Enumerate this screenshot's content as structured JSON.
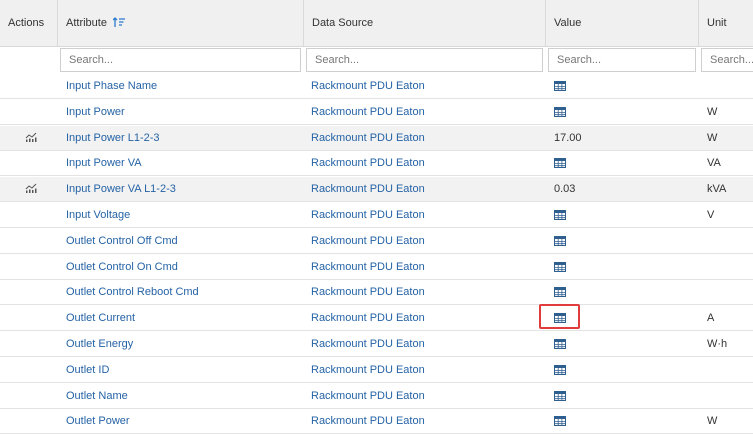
{
  "header": {
    "actions": "Actions",
    "attribute": "Attribute",
    "data_source": "Data Source",
    "value": "Value",
    "unit": "Unit"
  },
  "search": {
    "attribute_placeholder": "Search...",
    "data_source_placeholder": "Search...",
    "value_placeholder": "Search...",
    "unit_placeholder": "Search..."
  },
  "rows": [
    {
      "attribute": "Input Phase Name",
      "source": "Rackmount PDU Eaton",
      "value": "",
      "unit": "",
      "value_icon": "table-icon",
      "action_icon": ""
    },
    {
      "attribute": "Input Power",
      "source": "Rackmount PDU Eaton",
      "value": "",
      "unit": "W",
      "value_icon": "table-icon",
      "action_icon": ""
    },
    {
      "attribute": "Input Power L1-2-3",
      "source": "Rackmount PDU Eaton",
      "value": "17.00",
      "unit": "W",
      "value_icon": "",
      "action_icon": "trend-chart-icon"
    },
    {
      "attribute": "Input Power VA",
      "source": "Rackmount PDU Eaton",
      "value": "",
      "unit": "VA",
      "value_icon": "table-icon",
      "action_icon": ""
    },
    {
      "attribute": "Input Power VA L1-2-3",
      "source": "Rackmount PDU Eaton",
      "value": "0.03",
      "unit": "kVA",
      "value_icon": "",
      "action_icon": "trend-chart-icon"
    },
    {
      "attribute": "Input Voltage",
      "source": "Rackmount PDU Eaton",
      "value": "",
      "unit": "V",
      "value_icon": "table-icon",
      "action_icon": ""
    },
    {
      "attribute": "Outlet Control Off Cmd",
      "source": "Rackmount PDU Eaton",
      "value": "",
      "unit": "",
      "value_icon": "table-icon",
      "action_icon": ""
    },
    {
      "attribute": "Outlet Control On Cmd",
      "source": "Rackmount PDU Eaton",
      "value": "",
      "unit": "",
      "value_icon": "table-icon",
      "action_icon": ""
    },
    {
      "attribute": "Outlet Control Reboot Cmd",
      "source": "Rackmount PDU Eaton",
      "value": "",
      "unit": "",
      "value_icon": "table-icon",
      "action_icon": ""
    },
    {
      "attribute": "Outlet Current",
      "source": "Rackmount PDU Eaton",
      "value": "",
      "unit": "A",
      "value_icon": "table-icon",
      "action_icon": ""
    },
    {
      "attribute": "Outlet Energy",
      "source": "Rackmount PDU Eaton",
      "value": "",
      "unit": "W·h",
      "value_icon": "table-icon",
      "action_icon": ""
    },
    {
      "attribute": "Outlet ID",
      "source": "Rackmount PDU Eaton",
      "value": "",
      "unit": "",
      "value_icon": "table-icon",
      "action_icon": ""
    },
    {
      "attribute": "Outlet Name",
      "source": "Rackmount PDU Eaton",
      "value": "",
      "unit": "",
      "value_icon": "table-icon",
      "action_icon": ""
    },
    {
      "attribute": "Outlet Power",
      "source": "Rackmount PDU Eaton",
      "value": "",
      "unit": "W",
      "value_icon": "table-icon",
      "action_icon": ""
    }
  ],
  "colors": {
    "link": "#2563a6",
    "header_bg": "#f0f0f0",
    "alt_row_bg": "#f2f2f2",
    "highlight_border": "#e03c3c"
  }
}
